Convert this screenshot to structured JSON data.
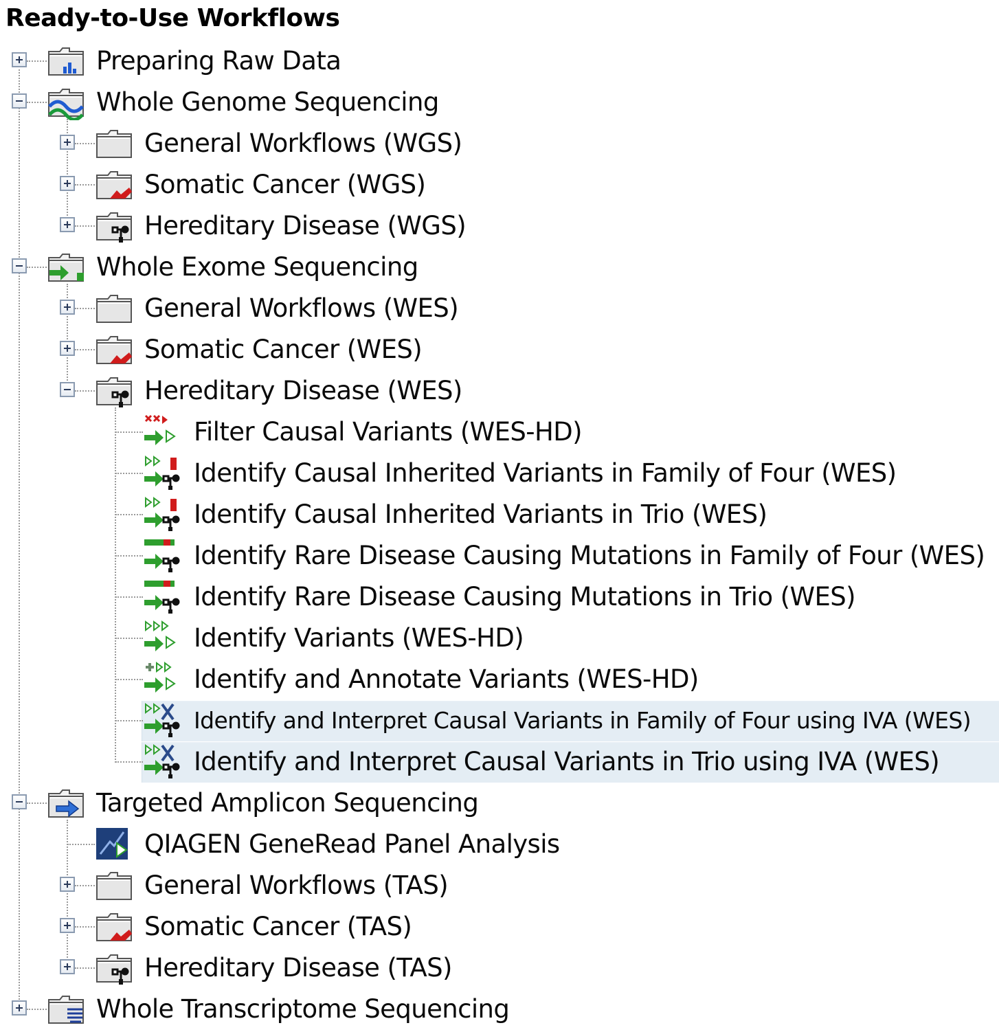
{
  "title": "Ready-to-Use Workflows",
  "tree": [
    {
      "id": "preparing-raw-data",
      "label": "Preparing Raw Data",
      "level": 0,
      "expandable": true,
      "expanded": false,
      "icon": "folder-chart-icon"
    },
    {
      "id": "whole-genome-sequencing",
      "label": "Whole Genome Sequencing",
      "level": 0,
      "expandable": true,
      "expanded": true,
      "icon": "folder-dna-icon"
    },
    {
      "id": "general-workflows-wgs",
      "label": "General Workflows (WGS)",
      "level": 1,
      "expandable": true,
      "expanded": false,
      "icon": "folder-icon"
    },
    {
      "id": "somatic-cancer-wgs",
      "label": "Somatic Cancer (WGS)",
      "level": 1,
      "expandable": true,
      "expanded": false,
      "icon": "folder-cancer-icon"
    },
    {
      "id": "hereditary-disease-wgs",
      "label": "Hereditary Disease (WGS)",
      "level": 1,
      "expandable": true,
      "expanded": false,
      "icon": "folder-pedigree-icon"
    },
    {
      "id": "whole-exome-sequencing",
      "label": "Whole Exome Sequencing",
      "level": 0,
      "expandable": true,
      "expanded": true,
      "icon": "folder-exome-icon"
    },
    {
      "id": "general-workflows-wes",
      "label": "General Workflows (WES)",
      "level": 1,
      "expandable": true,
      "expanded": false,
      "icon": "folder-icon"
    },
    {
      "id": "somatic-cancer-wes",
      "label": "Somatic Cancer (WES)",
      "level": 1,
      "expandable": true,
      "expanded": false,
      "icon": "folder-cancer-icon"
    },
    {
      "id": "hereditary-disease-wes",
      "label": "Hereditary Disease (WES)",
      "level": 1,
      "expandable": true,
      "expanded": true,
      "icon": "folder-pedigree-icon"
    },
    {
      "id": "filter-causal-variants",
      "label": "Filter Causal Variants (WES-HD)",
      "level": 2,
      "expandable": false,
      "icon": "workflow-filter-icon"
    },
    {
      "id": "identify-causal-inherited-family-four",
      "label": "Identify Causal Inherited Variants in Family of Four (WES)",
      "level": 2,
      "expandable": false,
      "icon": "workflow-family-icon"
    },
    {
      "id": "identify-causal-inherited-trio",
      "label": "Identify Causal Inherited Variants in Trio (WES)",
      "level": 2,
      "expandable": false,
      "icon": "workflow-trio-icon"
    },
    {
      "id": "identify-rare-disease-family-four",
      "label": "Identify Rare Disease Causing Mutations in Family of Four (WES)",
      "level": 2,
      "expandable": false,
      "icon": "workflow-rare-family-icon"
    },
    {
      "id": "identify-rare-disease-trio",
      "label": "Identify Rare Disease Causing Mutations in Trio (WES)",
      "level": 2,
      "expandable": false,
      "icon": "workflow-rare-trio-icon"
    },
    {
      "id": "identify-variants-wes-hd",
      "label": "Identify Variants (WES-HD)",
      "level": 2,
      "expandable": false,
      "icon": "workflow-variants-icon"
    },
    {
      "id": "identify-annotate-variants",
      "label": "Identify and Annotate Variants (WES-HD)",
      "level": 2,
      "expandable": false,
      "icon": "workflow-annotate-icon"
    },
    {
      "id": "identify-interpret-family-four-iva",
      "label": "Identify and Interpret Causal Variants in Family of Four using IVA (WES)",
      "level": 2,
      "expandable": false,
      "icon": "workflow-iva-family-icon",
      "selected": true
    },
    {
      "id": "identify-interpret-trio-iva",
      "label": "Identify and Interpret Causal Variants in Trio using IVA (WES)",
      "level": 2,
      "expandable": false,
      "icon": "workflow-iva-trio-icon",
      "selected": true
    },
    {
      "id": "targeted-amplicon-sequencing",
      "label": "Targeted Amplicon Sequencing",
      "level": 0,
      "expandable": true,
      "expanded": true,
      "icon": "folder-amplicon-icon"
    },
    {
      "id": "qiagen-generead-panel",
      "label": "QIAGEN GeneRead Panel Analysis",
      "level": 1,
      "expandable": false,
      "icon": "workflow-qiagen-icon"
    },
    {
      "id": "general-workflows-tas",
      "label": "General Workflows (TAS)",
      "level": 1,
      "expandable": true,
      "expanded": false,
      "icon": "folder-icon"
    },
    {
      "id": "somatic-cancer-tas",
      "label": "Somatic Cancer (TAS)",
      "level": 1,
      "expandable": true,
      "expanded": false,
      "icon": "folder-cancer-icon"
    },
    {
      "id": "hereditary-disease-tas",
      "label": "Hereditary Disease (TAS)",
      "level": 1,
      "expandable": true,
      "expanded": false,
      "icon": "folder-pedigree-icon"
    },
    {
      "id": "whole-transcriptome-sequencing",
      "label": "Whole Transcriptome Sequencing",
      "level": 0,
      "expandable": true,
      "expanded": false,
      "icon": "folder-transcriptome-icon"
    }
  ],
  "colors": {
    "selection": "#e4edf4",
    "connector": "#9a9a9a",
    "folder": "#e8e8e8",
    "workflow_green": "#2e9e2e",
    "cancer_red": "#d01c1c",
    "arrow_blue": "#2f6fd6"
  }
}
